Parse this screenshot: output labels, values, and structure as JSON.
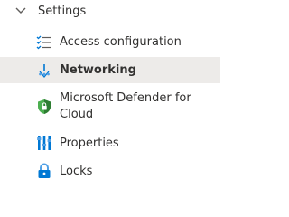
{
  "settings": {
    "header": "Settings",
    "items": [
      {
        "label": "Access configuration",
        "icon": "list-check-icon",
        "selected": false
      },
      {
        "label": "Networking",
        "icon": "network-icon",
        "selected": true
      },
      {
        "label": "Microsoft Defender for Cloud",
        "icon": "shield-check-icon",
        "selected": false
      },
      {
        "label": "Properties",
        "icon": "bars-icon",
        "selected": false
      },
      {
        "label": "Locks",
        "icon": "lock-icon",
        "selected": false
      }
    ]
  },
  "colors": {
    "selected_background": "#edebe9",
    "text": "#323130",
    "icon_blue": "#0078d4",
    "shield_green": "#4caf50"
  }
}
